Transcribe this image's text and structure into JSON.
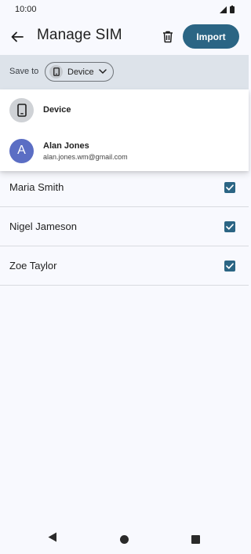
{
  "status_bar": {
    "time": "10:00"
  },
  "header": {
    "title": "Manage SIM",
    "import_label": "Import"
  },
  "save_to": {
    "label": "Save to",
    "selected": "Device"
  },
  "dropdown": {
    "items": [
      {
        "name": "Device",
        "icon": "phone-icon"
      },
      {
        "name": "Alan Jones",
        "email": "alan.jones.wm@gmail.com",
        "avatar_letter": "A",
        "avatar_color": "#5b6ec4"
      }
    ]
  },
  "contacts": [
    {
      "name": "Maria Smith",
      "checked": true
    },
    {
      "name": "Nigel Jameson",
      "checked": true
    },
    {
      "name": "Zoe Taylor",
      "checked": true
    }
  ],
  "colors": {
    "accent": "#2b6584",
    "save_bar_bg": "#dde3ea",
    "page_bg": "#f8f9fe"
  }
}
